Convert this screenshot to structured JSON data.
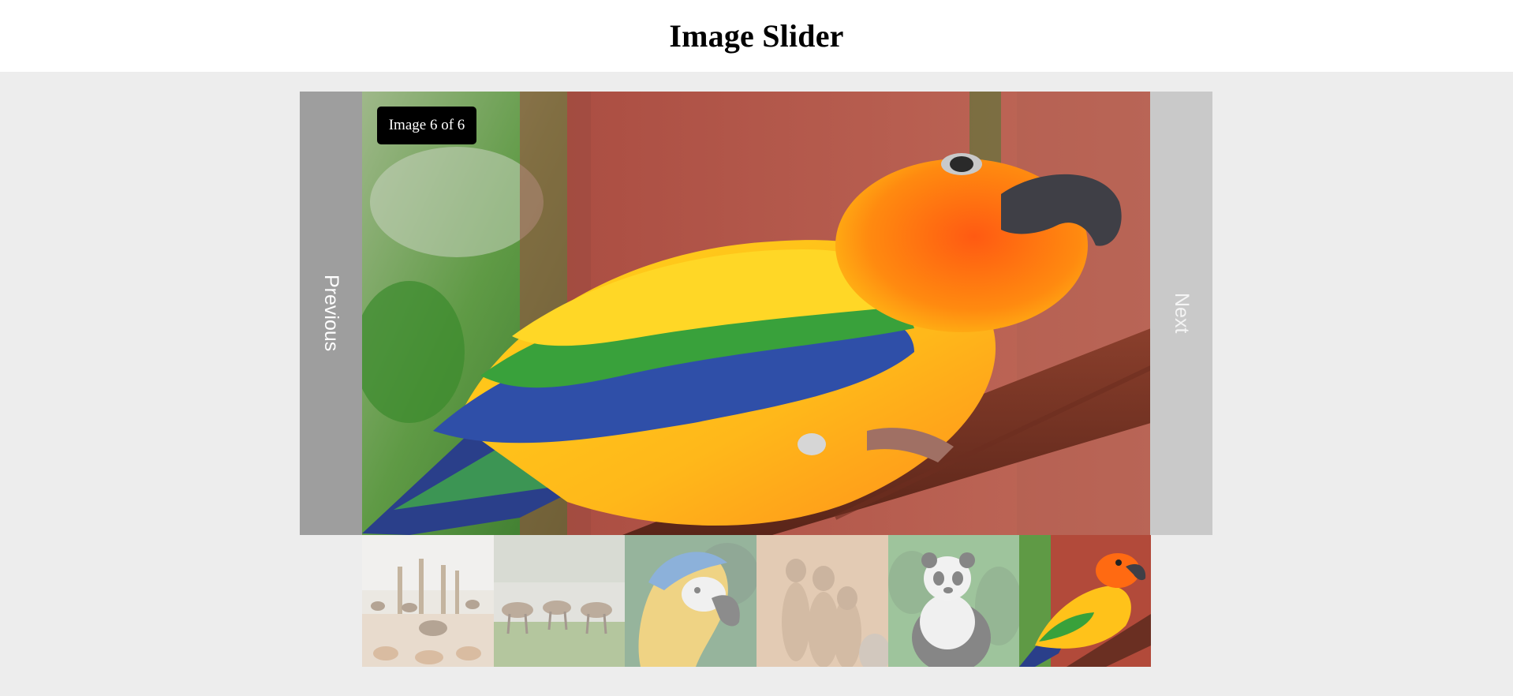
{
  "page": {
    "title": "Image Slider"
  },
  "slider": {
    "prev_label": "Previous",
    "next_label": "Next",
    "counter": "Image 6 of 6",
    "current_index": 6,
    "total": 6,
    "current_image": "parrot"
  },
  "thumbnails": [
    {
      "subject": "giraffes-and-antelopes",
      "active": false
    },
    {
      "subject": "antelopes-grazing",
      "active": false
    },
    {
      "subject": "macaw",
      "active": false
    },
    {
      "subject": "meerkats",
      "active": false
    },
    {
      "subject": "panda",
      "active": false
    },
    {
      "subject": "parrot",
      "active": true
    }
  ],
  "colors": {
    "page_background": "#ededed",
    "header_background": "#ffffff",
    "prev_button": "#9e9e9e",
    "next_button": "#c9c9c9",
    "counter_background": "#000000"
  }
}
